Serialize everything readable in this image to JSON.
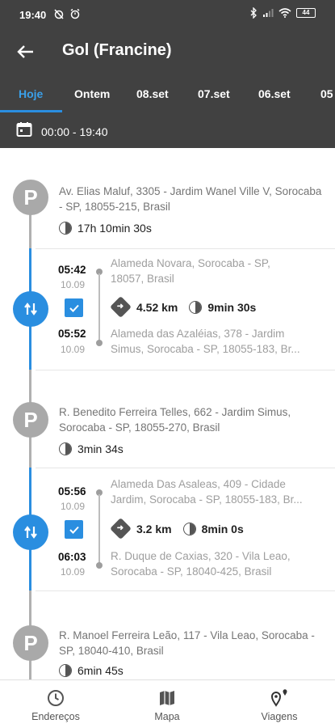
{
  "status": {
    "time": "19:40",
    "battery": "44"
  },
  "header": {
    "title": "Gol (Francine)"
  },
  "tabs": [
    {
      "label": "Hoje",
      "active": true
    },
    {
      "label": "Ontem"
    },
    {
      "label": "08.set"
    },
    {
      "label": "07.set"
    },
    {
      "label": "06.set"
    },
    {
      "label": "05"
    }
  ],
  "daterange": {
    "text": "00:00 - 19:40"
  },
  "stops": [
    {
      "icon_text": "P",
      "address": "Av. Elias Maluf, 3305 - Jardim Wanel Ville V, Sorocaba - SP, 18055-215, Brasil",
      "duration": "17h 10min 30s"
    },
    {
      "icon_text": "P",
      "address": "R. Benedito Ferreira Telles, 662 - Jardim Simus, Sorocaba - SP, 18055-270, Brasil",
      "duration": "3min 34s"
    },
    {
      "icon_text": "P",
      "address": "R. Manoel Ferreira Leão, 117 - Vila Leao, Sorocaba - SP, 18040-410, Brasil",
      "duration": "6min 45s"
    }
  ],
  "trips": [
    {
      "start_time": "05:42",
      "start_date": "10.09",
      "start_address_1": "Alameda Novara, Sorocaba - SP,",
      "start_address_2": "18057, Brasil",
      "distance": "4.52 km",
      "duration": "9min 30s",
      "end_time": "05:52",
      "end_date": "10.09",
      "end_address_1": "Alameda das Azaléias, 378 - Jardim",
      "end_address_2": "Simus, Sorocaba - SP, 18055-183, Br..."
    },
    {
      "start_time": "05:56",
      "start_date": "10.09",
      "start_address_1": "Alameda Das Asaleas, 409 - Cidade",
      "start_address_2": "Jardim, Sorocaba - SP, 18055-183, Br...",
      "distance": "3.2 km",
      "duration": "8min 0s",
      "end_time": "06:03",
      "end_date": "10.09",
      "end_address_1": "R. Duque de Caxias, 320 - Vila Leao,",
      "end_address_2": "Sorocaba - SP, 18040-425, Brasil"
    }
  ],
  "bottom_nav": [
    {
      "label": "Endereços",
      "icon": "clock-icon"
    },
    {
      "label": "Mapa",
      "icon": "map-icon"
    },
    {
      "label": "Viagens",
      "icon": "route-pin-icon"
    }
  ],
  "colors": {
    "header_bg": "#414141",
    "accent": "#2a8ee0",
    "stop_gray": "#a9a9a9"
  }
}
